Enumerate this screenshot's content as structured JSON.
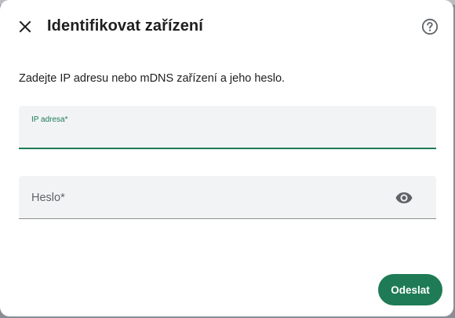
{
  "dialog": {
    "title": "Identifikovat zařízení",
    "description": "Zadejte IP adresu nebo mDNS zařízení a jeho heslo.",
    "close_icon": "close-icon",
    "help_icon": "help-circle-icon"
  },
  "ip_field": {
    "label": "IP adresa*",
    "value": ""
  },
  "password_field": {
    "label": "Heslo*",
    "value": "",
    "visibility_icon": "eye-icon"
  },
  "actions": {
    "submit_label": "Odeslat"
  },
  "colors": {
    "accent": "#1e7b55",
    "field_bg": "#f2f3f5",
    "text": "#1f1f1f"
  }
}
